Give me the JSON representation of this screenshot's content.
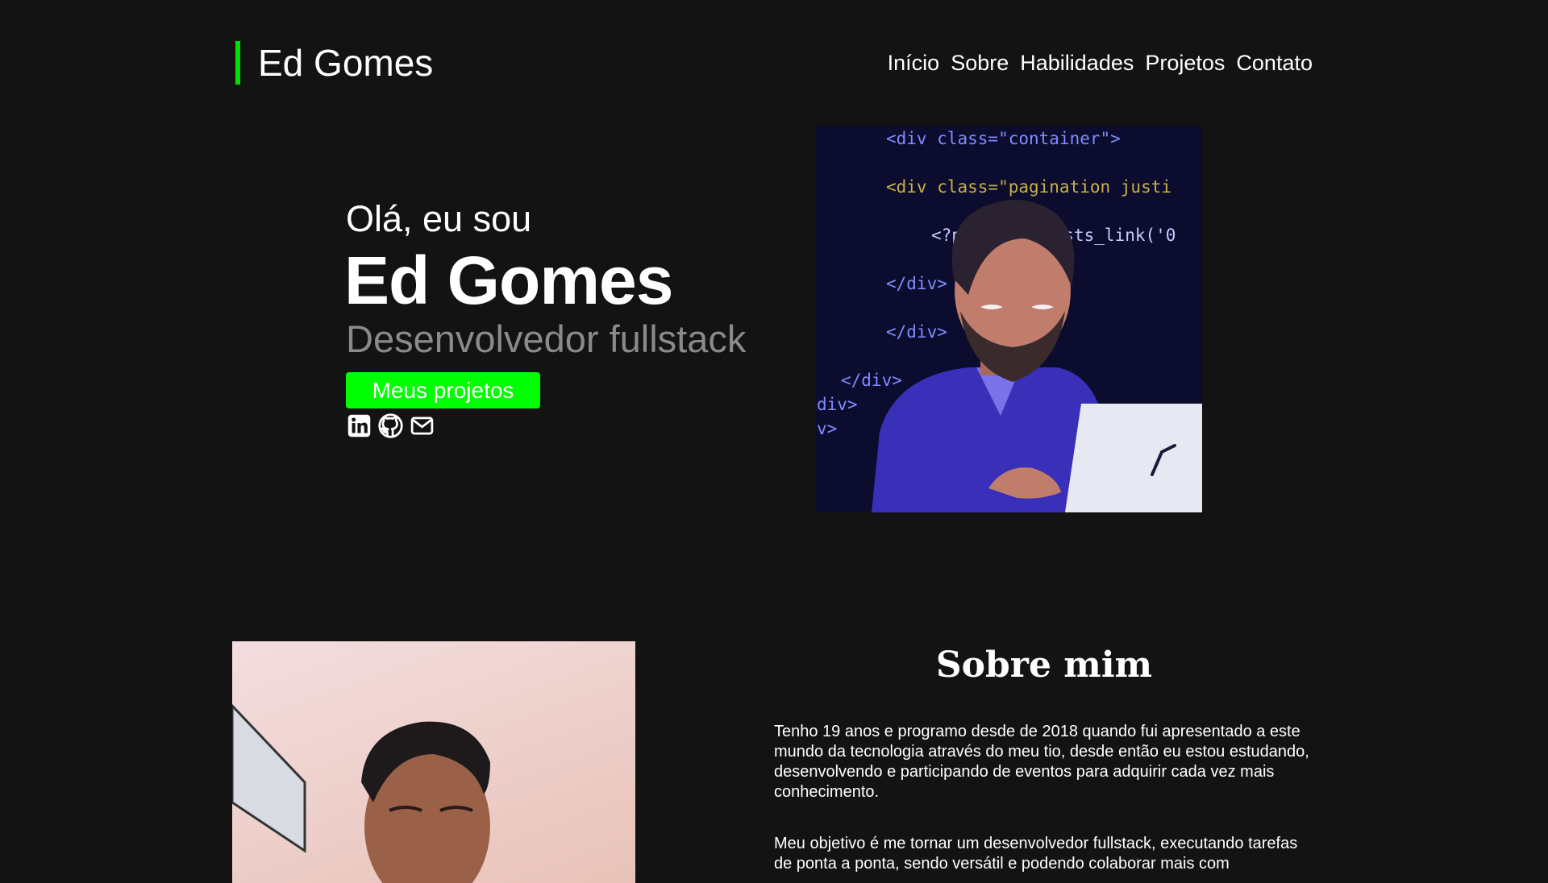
{
  "header": {
    "logo": "Ed Gomes",
    "nav": [
      "Início",
      "Sobre",
      "Habilidades",
      "Projetos",
      "Contato"
    ]
  },
  "hero": {
    "greeting": "Olá, eu sou",
    "name": "Ed Gomes",
    "role": "Desenvolvedor fullstack",
    "cta": "Meus projetos",
    "socials": [
      "linkedin-icon",
      "github-icon",
      "mail-icon"
    ]
  },
  "illustration": {
    "code_lines": [
      "<div class=\"container\">",
      "<div class=\"pagination justi",
      "<?php next_posts_link('0",
      "</div>",
      "</div>",
      "</div>",
      "div>",
      "v>"
    ]
  },
  "about": {
    "title": "Sobre mim",
    "paragraphs": [
      "Tenho 19 anos e programo desde de 2018 quando fui apresentado a este mundo da tecnologia através do meu tio, desde então eu estou estudando, desenvolvendo e participando de eventos para adquirir cada vez mais conhecimento.",
      "Meu objetivo é me tornar um desenvolvedor fullstack, executando tarefas de ponta a ponta, sendo versátil e podendo colaborar mais com"
    ]
  },
  "colors": {
    "background": "#131313",
    "accent": "#00ff00",
    "muted": "#8a8a8a"
  }
}
